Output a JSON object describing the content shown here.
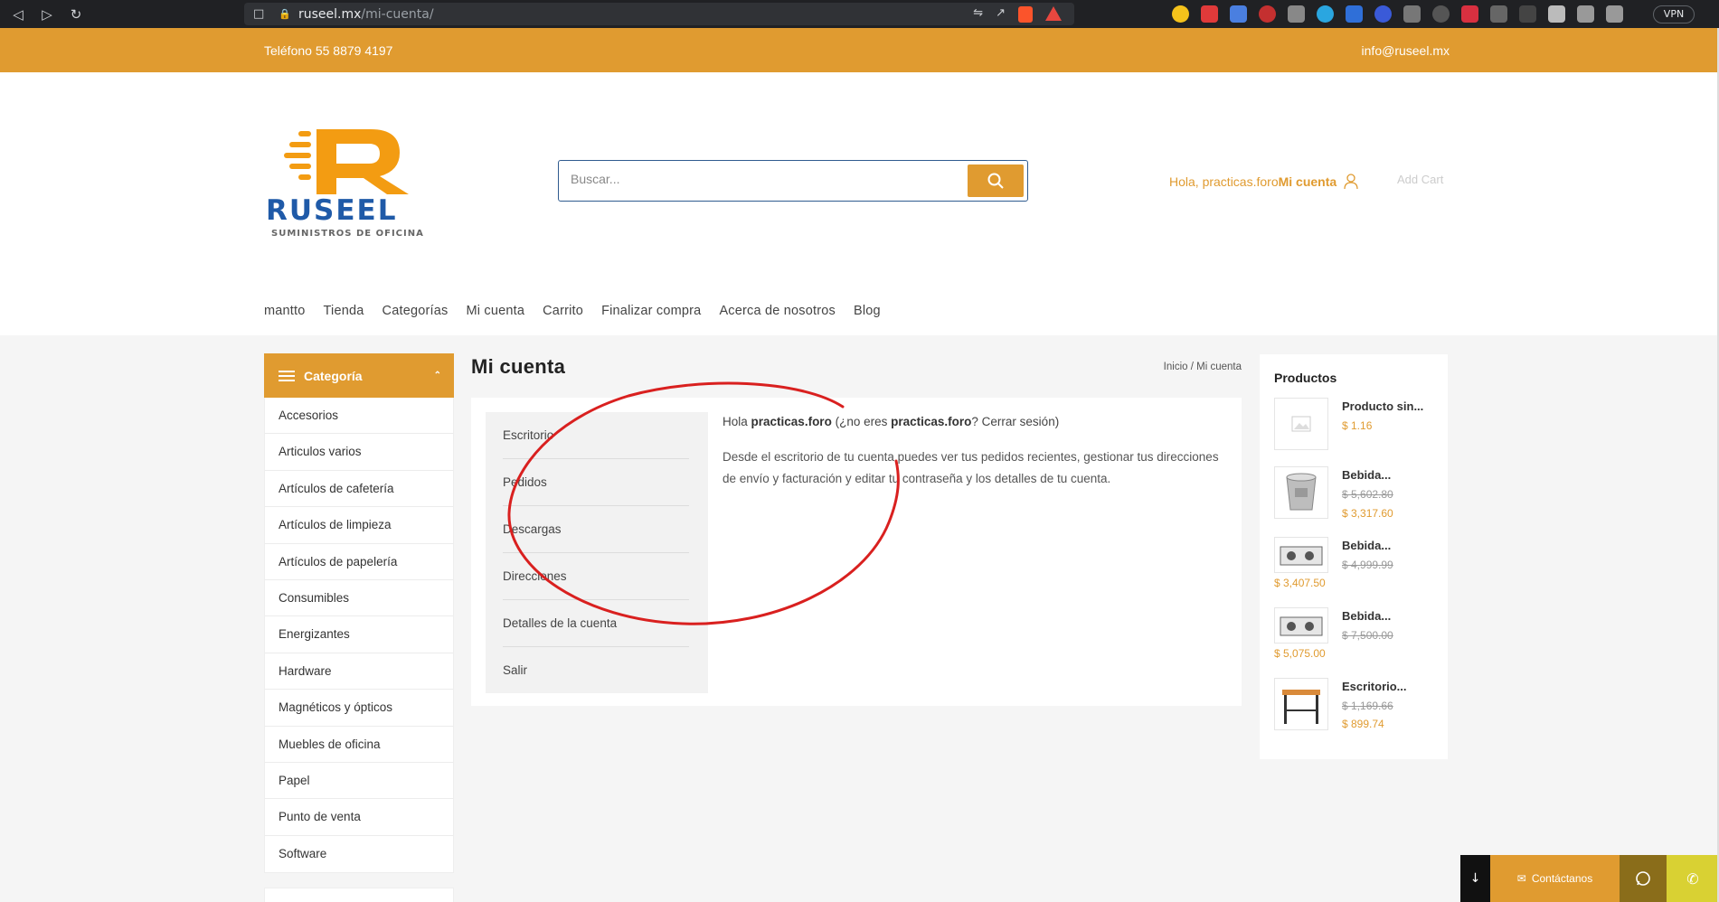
{
  "browser": {
    "url_host": "ruseel.mx",
    "url_path": "/mi-cuenta/",
    "vpn_label": "VPN"
  },
  "topbar": {
    "phone": "Teléfono 55 8879 4197",
    "email": "info@ruseel.mx"
  },
  "logo": {
    "brand": "RUSEEL",
    "tagline": "SUMINISTROS DE OFICINA"
  },
  "search": {
    "placeholder": "Buscar..."
  },
  "account": {
    "greeting": "Hola, practicas.foro",
    "link": "Mi cuenta",
    "cart": "Add Cart"
  },
  "menu": [
    "mantto",
    "Tienda",
    "Categorías",
    "Mi cuenta",
    "Carrito",
    "Finalizar compra",
    "Acerca de nosotros",
    "Blog"
  ],
  "sidebar": {
    "title": "Categoría",
    "items": [
      "Accesorios",
      "Articulos varios",
      "Artículos de cafetería",
      "Artículos de limpieza",
      "Artículos de papelería",
      "Consumibles",
      "Energizantes",
      "Hardware",
      "Magnéticos y ópticos",
      "Muebles de oficina",
      "Papel",
      "Punto de venta",
      "Software"
    ]
  },
  "page": {
    "title": "Mi cuenta",
    "breadcrumb_home": "Inicio",
    "breadcrumb_sep": "/",
    "breadcrumb_current": "Mi cuenta"
  },
  "account_nav": [
    "Escritorio",
    "Pedidos",
    "Descargas",
    "Direcciones",
    "Detalles de la cuenta",
    "Salir"
  ],
  "dashboard": {
    "hello": "Hola",
    "user": "practicas.foro",
    "not_you_open": "(¿no eres",
    "user2": "practicas.foro",
    "logout": "Cerrar sesión",
    "not_you_close": ")",
    "description": "Desde el escritorio de tu cuenta puedes ver tus pedidos recientes, gestionar tus direcciones de envío y facturación y editar tu contraseña y los detalles de tu cuenta."
  },
  "products": {
    "title": "Productos",
    "items": [
      {
        "name": "Producto sin...",
        "old_price": "",
        "price": "$ 1.16"
      },
      {
        "name": "Bebida...",
        "old_price": "$ 5,602.80",
        "price": "$ 3,317.60"
      },
      {
        "name": "Bebida...",
        "old_price": "$ 4,999.99",
        "price": "$ 3,407.50"
      },
      {
        "name": "Bebida...",
        "old_price": "$ 7,500.00",
        "price": "$ 5,075.00"
      },
      {
        "name": "Escritorio...",
        "old_price": "$ 1,169.66",
        "price": "$ 899.74"
      }
    ]
  },
  "float_bar": {
    "contact": "Contáctanos"
  },
  "colors": {
    "accent": "#e09b30",
    "annotation": "#d9201f"
  }
}
